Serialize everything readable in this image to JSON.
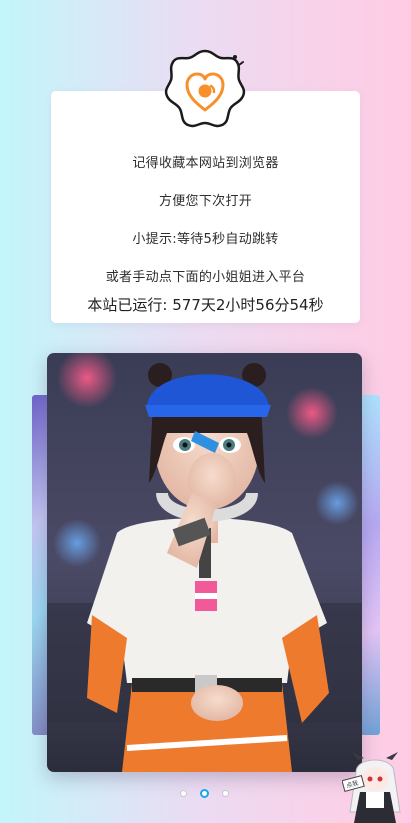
{
  "notice": {
    "line1": "记得收藏本网站到浏览器",
    "line2": "方便您下次打开",
    "line3": "小提示:等待5秒自动跳转",
    "line4": "或者手动点下面的小姐姐进入平台"
  },
  "runtime": {
    "prefix": "本站已运行:",
    "value": "577天2小时56分54秒"
  },
  "badge": {
    "icon": "heart-bookmark-icon",
    "color": "#f7902b"
  },
  "carousel": {
    "slides": [
      "slide-left",
      "slide-main",
      "slide-right"
    ],
    "active_index": 2,
    "total": 3
  },
  "mascot": {
    "icon": "anime-mascot-icon",
    "sign_text": "点我"
  },
  "colors": {
    "accent": "#18a6ec",
    "bg_left": "#c2f6fb",
    "bg_right": "#ffcbe4",
    "badge_orange": "#f7902b"
  }
}
